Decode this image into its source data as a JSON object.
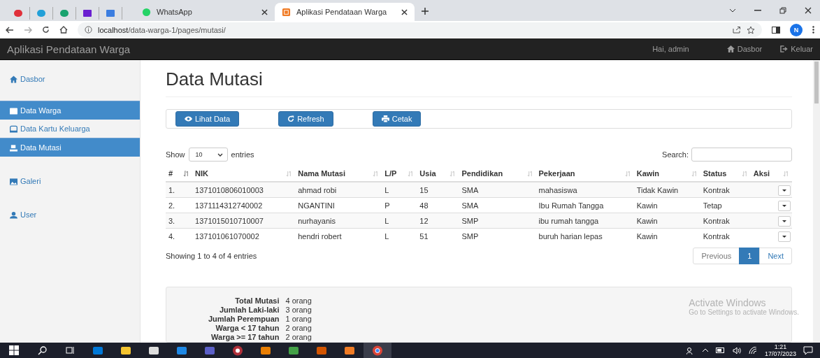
{
  "browser": {
    "tabs": [
      {
        "label": "WhatsApp",
        "selected": false
      },
      {
        "label": "Aplikasi Pendataan Warga",
        "selected": true
      }
    ],
    "url_host": "localhost",
    "url_path": "/data-warga-1/pages/mutasi/",
    "profile": "N"
  },
  "navbar": {
    "brand": "Aplikasi Pendataan Warga",
    "greeting": "Hai, admin",
    "links": [
      "Dasbor",
      "Keluar"
    ]
  },
  "sidebar": {
    "items": [
      {
        "label": "Dasbor",
        "selected": false
      },
      {
        "label": "Data Warga",
        "selected": true
      },
      {
        "label": "Data Kartu Keluarga",
        "selected": false
      },
      {
        "label": "Data Mutasi",
        "selected": true
      },
      {
        "label": "Galeri",
        "selected": false
      },
      {
        "label": "User",
        "selected": false
      }
    ]
  },
  "page_title": "Data Mutasi",
  "buttons": [
    "Lihat Data",
    "Refresh",
    "Cetak"
  ],
  "table": {
    "length_label": "Show",
    "length_value": "10",
    "entries_label": "entries",
    "search_label": "Search:",
    "columns": [
      "#",
      "NIK",
      "Nama Mutasi",
      "L/P",
      "Usia",
      "Pendidikan",
      "Pekerjaan",
      "Kawin",
      "Status",
      "Aksi"
    ],
    "rows": [
      [
        "1.",
        "1371010806010003",
        "ahmad robi",
        "L",
        "15",
        "SMA",
        "mahasiswa",
        "Tidak Kawin",
        "Kontrak"
      ],
      [
        "2.",
        "1371114312740002",
        "NGANTINI",
        "P",
        "48",
        "SMA",
        "Ibu Rumah Tangga",
        "Kawin",
        "Tetap"
      ],
      [
        "3.",
        "1371015010710007",
        "nurhayanis",
        "L",
        "12",
        "SMP",
        "ibu rumah tangga",
        "Kawin",
        "Kontrak"
      ],
      [
        "4.",
        "137101061070002",
        "hendri robert",
        "L",
        "51",
        "SMP",
        "buruh harian lepas",
        "Kawin",
        "Kontrak"
      ]
    ],
    "info": "Showing 1 to 4 of 4 entries",
    "pagination": {
      "previous": "Previous",
      "pages": [
        {
          "label": "1",
          "selected": true
        }
      ],
      "next": "Next"
    }
  },
  "summary": [
    {
      "label": "Total Mutasi",
      "value": "4 orang"
    },
    {
      "label": "Jumlah Laki-laki",
      "value": "3 orang"
    },
    {
      "label": "Jumlah Perempuan",
      "value": "1 orang"
    },
    {
      "label": "Warga < 17 tahun",
      "value": "2 orang"
    },
    {
      "label": "Warga >= 17 tahun",
      "value": "2 orang"
    }
  ],
  "activation_notice": {
    "title": "Activate Windows",
    "subtitle": "Go to Settings to activate Windows."
  },
  "taskbar": {
    "time": "1:21",
    "date": "17/07/2023"
  }
}
